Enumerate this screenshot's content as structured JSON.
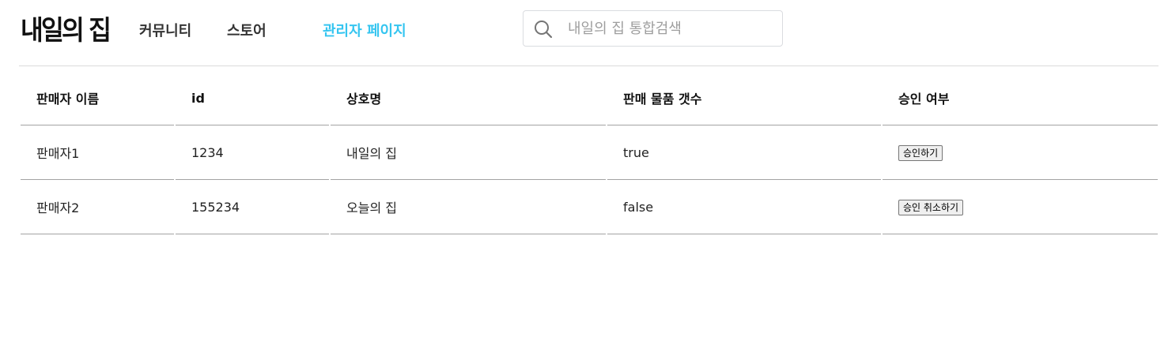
{
  "header": {
    "logo": "내일의 집",
    "nav": {
      "community": "커뮤니티",
      "store": "스토어",
      "admin": "관리자 페이지"
    },
    "search": {
      "placeholder": "내일의 집 통합검색",
      "value": ""
    },
    "accent_color": "#35c5f0"
  },
  "table": {
    "columns": [
      "판매자 이름",
      "id",
      "상호명",
      "판매 물품 갯수",
      "승인 여부"
    ],
    "rows": [
      {
        "seller_name": "판매자1",
        "id": "1234",
        "business_name": "내일의 집",
        "product_count": "true",
        "action_label": "승인하기"
      },
      {
        "seller_name": "판매자2",
        "id": "155234",
        "business_name": "오늘의 집",
        "product_count": "false",
        "action_label": "승인 취소하기"
      }
    ]
  }
}
